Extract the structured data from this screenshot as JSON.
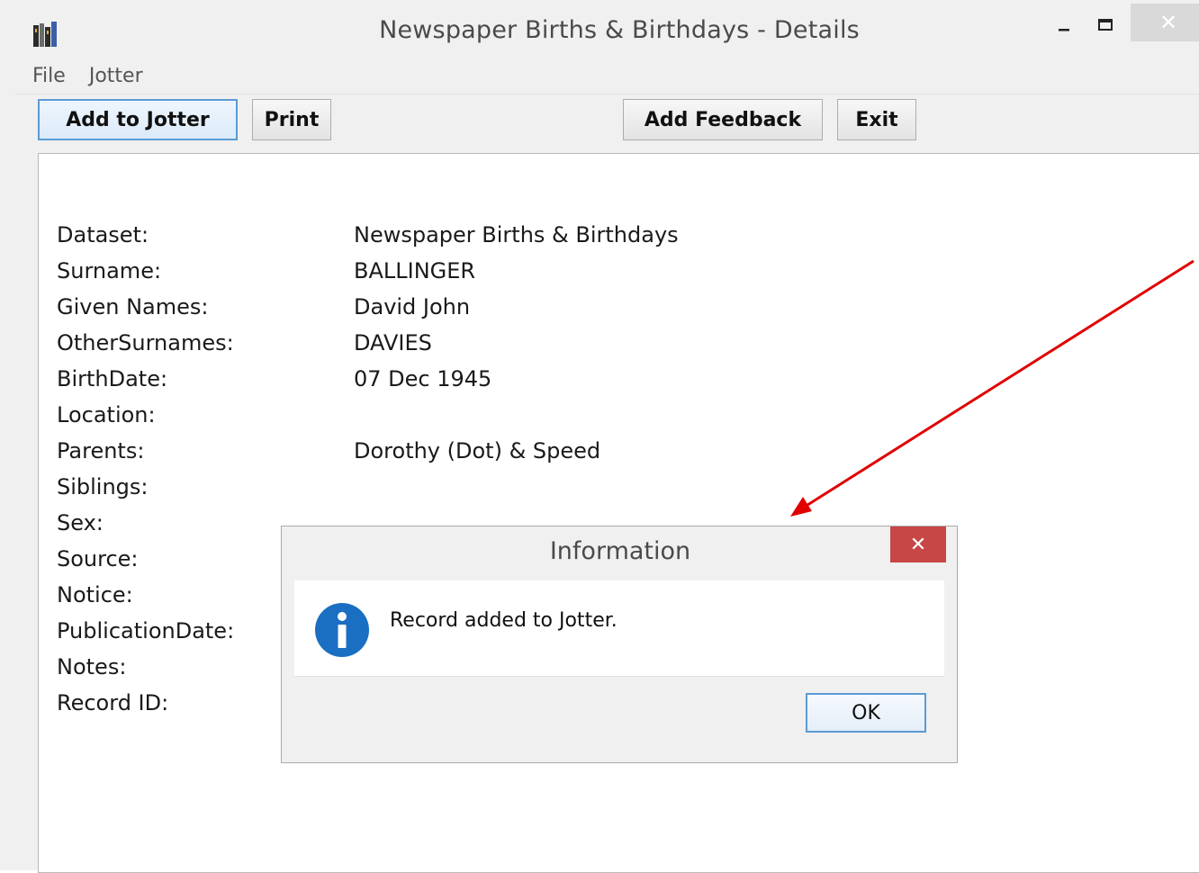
{
  "window": {
    "title": "Newspaper Births & Birthdays - Details",
    "close_glyph": "✕"
  },
  "menu": {
    "items": [
      "File",
      "Jotter"
    ]
  },
  "toolbar": {
    "add_to_jotter": "Add to Jotter",
    "print": "Print",
    "add_feedback": "Add Feedback",
    "exit": "Exit"
  },
  "record": {
    "fields": [
      {
        "label": "Dataset:",
        "value": "Newspaper Births & Birthdays"
      },
      {
        "label": "Surname:",
        "value": "BALLINGER"
      },
      {
        "label": "Given Names:",
        "value": "David John"
      },
      {
        "label": "OtherSurnames:",
        "value": "DAVIES"
      },
      {
        "label": "BirthDate:",
        "value": "07 Dec 1945"
      },
      {
        "label": "Location:",
        "value": ""
      },
      {
        "label": "Parents:",
        "value": "Dorothy (Dot) & Speed"
      },
      {
        "label": "Siblings:",
        "value": ""
      },
      {
        "label": "Sex:",
        "value": ""
      },
      {
        "label": "Source:",
        "value": ""
      },
      {
        "label": "Notice:",
        "value": ""
      },
      {
        "label": "PublicationDate:",
        "value": ""
      },
      {
        "label": "Notes:",
        "value": ""
      },
      {
        "label": "Record ID:",
        "value": ""
      }
    ]
  },
  "dialog": {
    "title": "Information",
    "message": "Record added to Jotter.",
    "ok_label": "OK",
    "close_glyph": "✕"
  },
  "colors": {
    "annotation_arrow": "#e00000",
    "dialog_close_bg": "#c74646",
    "info_icon": "#1b6fc2"
  }
}
